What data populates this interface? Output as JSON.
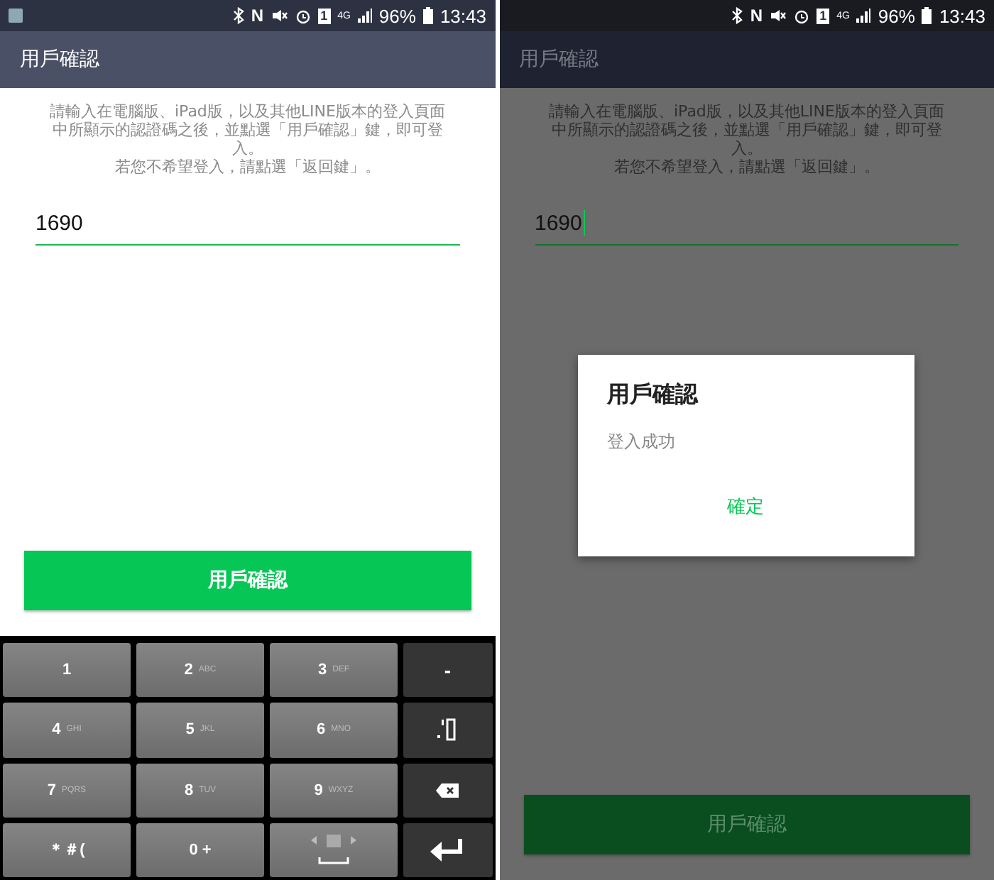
{
  "screens": [
    {
      "dimmed": false,
      "status_bar": {
        "nfc": "N",
        "sim": "1",
        "network": "4G",
        "battery": "96%",
        "time": "13:43",
        "notification": true
      },
      "title": "用戶確認",
      "instructions": [
        "請輸入在電腦版、iPad版，以及其他LINE版本的登入頁面中所顯示的認證碼之後，並點選「用戶確認」鍵，即可登入。",
        "若您不希望登入，請點選「返回鍵」。"
      ],
      "code_field": {
        "value": "1690",
        "cursor": false
      },
      "confirm_button": "用戶確認",
      "keyboard": [
        {
          "kind": "digit",
          "label": "1"
        },
        {
          "kind": "digit",
          "label": "2",
          "letters": "ABC"
        },
        {
          "kind": "digit",
          "label": "3",
          "letters": "DEF"
        },
        {
          "kind": "function",
          "label": "-"
        },
        {
          "kind": "digit",
          "label": "4",
          "letters": "GHI"
        },
        {
          "kind": "digit",
          "label": "5",
          "letters": "JKL"
        },
        {
          "kind": "digit",
          "label": "6",
          "letters": "MNO"
        },
        {
          "kind": "punctuation"
        },
        {
          "kind": "digit",
          "label": "7",
          "letters": "PQRS"
        },
        {
          "kind": "digit",
          "label": "8",
          "letters": "TUV"
        },
        {
          "kind": "digit",
          "label": "9",
          "letters": "WXYZ"
        },
        {
          "kind": "backspace"
        },
        {
          "kind": "digit",
          "label": "＊＃("
        },
        {
          "kind": "digit",
          "label": "0 +"
        },
        {
          "kind": "space"
        },
        {
          "kind": "enter"
        }
      ]
    },
    {
      "dimmed": true,
      "status_bar": {
        "nfc": "N",
        "sim": "1",
        "network": "4G",
        "battery": "96%",
        "time": "13:43",
        "notification": false
      },
      "title": "用戶確認",
      "instructions": [
        "請輸入在電腦版、iPad版，以及其他LINE版本的登入頁面中所顯示的認證碼之後，並點選「用戶確認」鍵，即可登入。",
        "若您不希望登入，請點選「返回鍵」。"
      ],
      "code_field": {
        "value": "1690",
        "cursor": true
      },
      "confirm_button": "用戶確認",
      "dialog": {
        "title": "用戶確認",
        "message": "登入成功",
        "button": "確定"
      }
    }
  ]
}
